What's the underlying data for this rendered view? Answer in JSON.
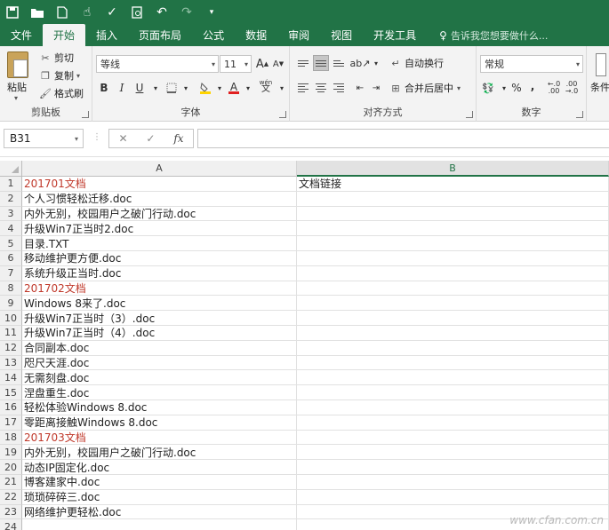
{
  "tabs": [
    "文件",
    "开始",
    "插入",
    "页面布局",
    "公式",
    "数据",
    "审阅",
    "视图",
    "开发工具"
  ],
  "tell_me": "告诉我您想要做什么...",
  "ribbon": {
    "clipboard": {
      "paste": "粘贴",
      "cut": "剪切",
      "copy": "复制",
      "format_painter": "格式刷",
      "label": "剪贴板"
    },
    "font": {
      "name": "等线",
      "size": "11",
      "label": "字体",
      "bold": "B",
      "italic": "I",
      "underline": "U",
      "grow": "A",
      "shrink": "A",
      "phonetic": "wén"
    },
    "alignment": {
      "wrap_text": "自动换行",
      "merge_center": "合并后居中",
      "label": "对齐方式"
    },
    "number": {
      "format": "常规",
      "percent": "%",
      "comma": ",",
      "label": "数字"
    },
    "styles": {
      "label_partial": "条件"
    }
  },
  "formula_bar": {
    "name_box": "B31",
    "fx": "fx"
  },
  "grid": {
    "columns": [
      "A",
      "B"
    ],
    "rows": [
      {
        "n": "1",
        "a": "201701文档",
        "b": "文档链接",
        "red": true
      },
      {
        "n": "2",
        "a": "个人习惯轻松迁移.doc",
        "b": ""
      },
      {
        "n": "3",
        "a": "内外无别，校园用户之破门行动.doc",
        "b": ""
      },
      {
        "n": "4",
        "a": "升级Win7正当时2.doc",
        "b": ""
      },
      {
        "n": "5",
        "a": "目录.TXT",
        "b": ""
      },
      {
        "n": "6",
        "a": "移动维护更方便.doc",
        "b": ""
      },
      {
        "n": "7",
        "a": "系统升级正当时.doc",
        "b": ""
      },
      {
        "n": "8",
        "a": "201702文档",
        "b": "",
        "red": true
      },
      {
        "n": "9",
        "a": "Windows 8来了.doc",
        "b": ""
      },
      {
        "n": "10",
        "a": "升级Win7正当时（3）.doc",
        "b": ""
      },
      {
        "n": "11",
        "a": "升级Win7正当时（4）.doc",
        "b": ""
      },
      {
        "n": "12",
        "a": "合同副本.doc",
        "b": ""
      },
      {
        "n": "13",
        "a": "咫尺天涯.doc",
        "b": ""
      },
      {
        "n": "14",
        "a": "无需刻盘.doc",
        "b": ""
      },
      {
        "n": "15",
        "a": "涅盘重生.doc",
        "b": ""
      },
      {
        "n": "16",
        "a": "轻松体验Windows 8.doc",
        "b": ""
      },
      {
        "n": "17",
        "a": "零距离接触Windows 8.doc",
        "b": ""
      },
      {
        "n": "18",
        "a": "201703文档",
        "b": "",
        "red": true
      },
      {
        "n": "19",
        "a": "内外无别，校园用户之破门行动.doc",
        "b": ""
      },
      {
        "n": "20",
        "a": "动态IP固定化.doc",
        "b": ""
      },
      {
        "n": "21",
        "a": "博客建家中.doc",
        "b": ""
      },
      {
        "n": "22",
        "a": "琐琐碎碎三.doc",
        "b": ""
      },
      {
        "n": "23",
        "a": "网络维护更轻松.doc",
        "b": ""
      },
      {
        "n": "24",
        "a": "",
        "b": ""
      }
    ]
  },
  "watermark": "www.cfan.com.cn",
  "colors": {
    "accent": "#217346",
    "red_text": "#c0392b"
  }
}
